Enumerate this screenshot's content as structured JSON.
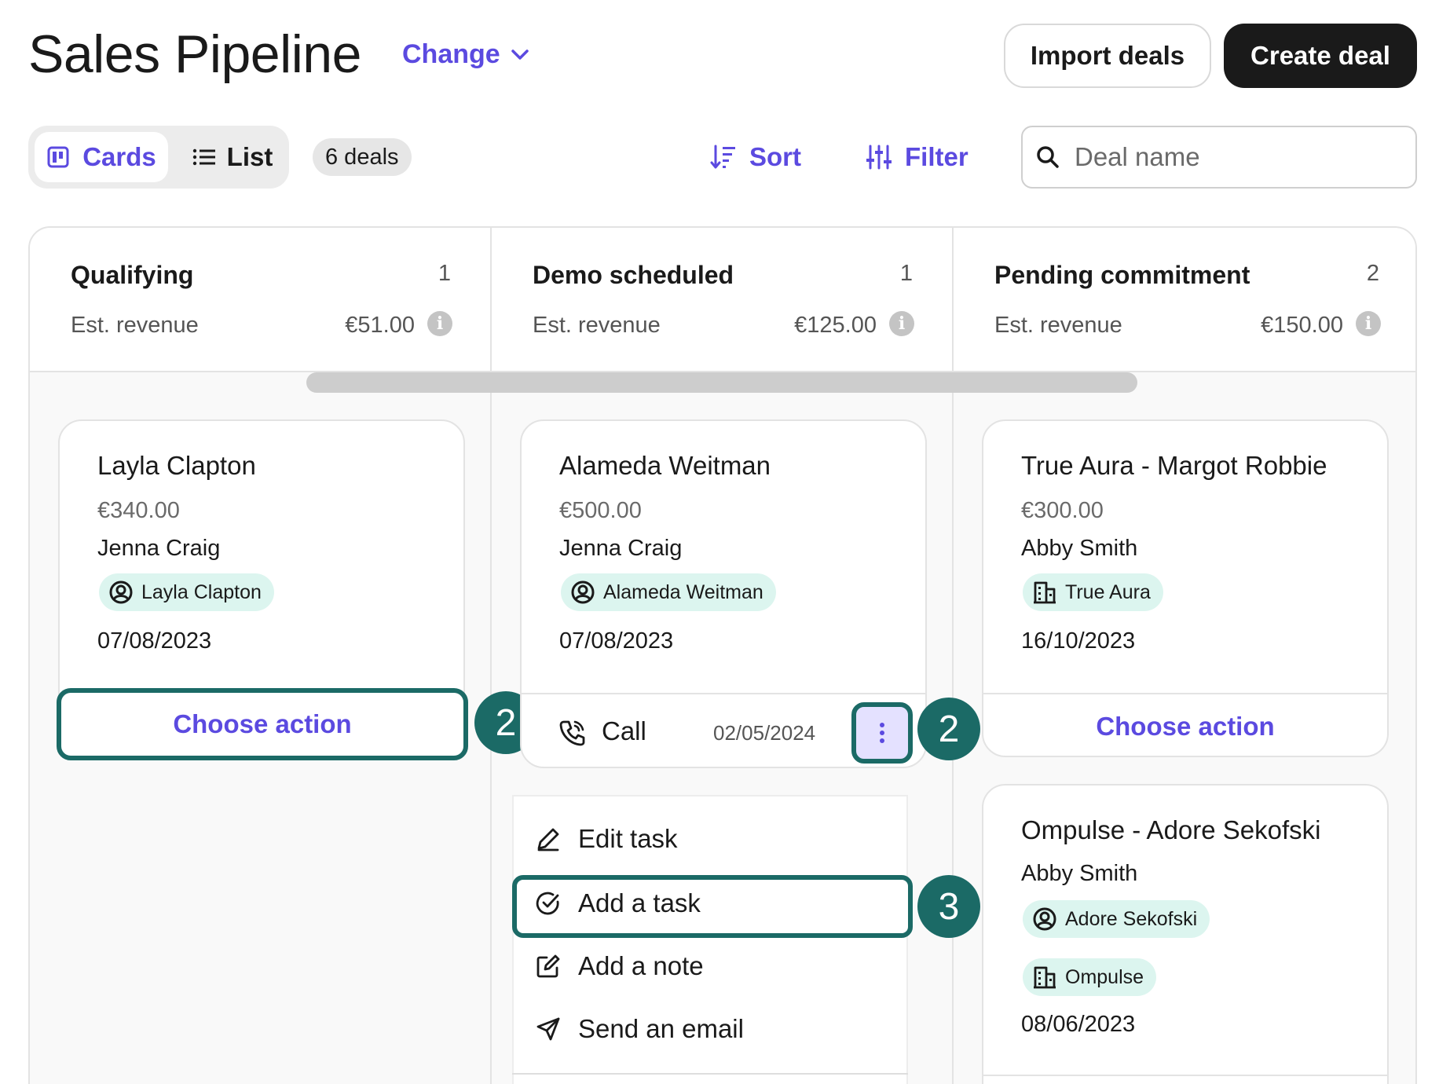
{
  "header": {
    "title": "Sales Pipeline",
    "change_label": "Change",
    "import_label": "Import deals",
    "create_label": "Create deal"
  },
  "toolbar": {
    "view_cards": "Cards",
    "view_list": "List",
    "deal_count": "6 deals",
    "sort_label": "Sort",
    "filter_label": "Filter",
    "search_placeholder": "Deal name"
  },
  "columns": [
    {
      "title": "Qualifying",
      "count": "1",
      "revenue_label": "Est. revenue",
      "revenue": "€51.00"
    },
    {
      "title": "Demo scheduled",
      "count": "1",
      "revenue_label": "Est. revenue",
      "revenue": "€125.00"
    },
    {
      "title": "Pending commitment",
      "count": "2",
      "revenue_label": "Est. revenue",
      "revenue": "€150.00"
    }
  ],
  "cards": [
    {
      "title": "Layla Clapton",
      "amount": "€340.00",
      "owner": "Jenna Craig",
      "tag": "Layla Clapton",
      "tag_icon": "person-circle-icon",
      "date": "07/08/2023",
      "action": "Choose action"
    },
    {
      "title": "Alameda Weitman",
      "amount": "€500.00",
      "owner": "Jenna Craig",
      "tag": "Alameda Weitman",
      "tag_icon": "person-circle-icon",
      "date": "07/08/2023",
      "task_type": "Call",
      "task_date": "02/05/2024"
    },
    {
      "title": "True Aura - Margot Robbie",
      "amount": "€300.00",
      "owner": "Abby Smith",
      "tag": "True Aura",
      "tag_icon": "building-icon",
      "date": "16/10/2023",
      "action": "Choose action"
    },
    {
      "title": "Ompulse - Adore Sekofski",
      "owner": "Abby Smith",
      "tag": "Adore Sekofski",
      "tag_icon": "person-circle-icon",
      "tag2": "Ompulse",
      "tag2_icon": "building-icon",
      "date": "08/06/2023"
    }
  ],
  "menu": {
    "items": [
      "Edit task",
      "Add a task",
      "Add a note",
      "Send an email"
    ]
  },
  "badges": [
    "2",
    "2",
    "3"
  ],
  "colors": {
    "accent": "#5b4ae0",
    "highlight": "#1b6a66",
    "tag_bg": "#dcf5ef",
    "dark_button": "#1a1a1a"
  }
}
